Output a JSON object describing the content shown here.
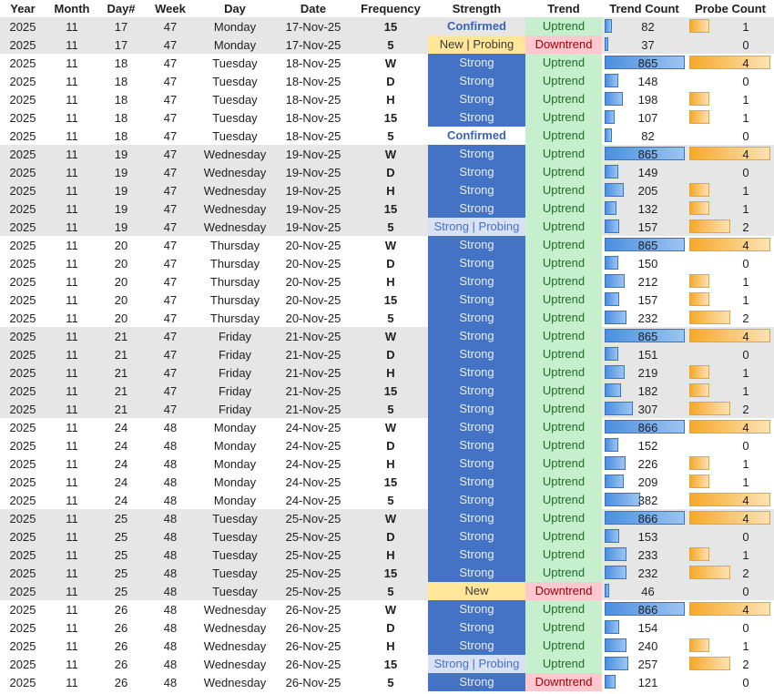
{
  "headers": {
    "year": "Year",
    "month": "Month",
    "day_num": "Day#",
    "week": "Week",
    "day": "Day",
    "date": "Date",
    "frequency": "Frequency",
    "strength": "Strength",
    "trend": "Trend",
    "trend_count": "Trend Count",
    "probe_count": "Probe Count"
  },
  "colors": {
    "strong_bg": "#4472c4",
    "uptrend_bg": "#c6efce",
    "downtrend_bg": "#ffc7ce",
    "new_bg": "#ffe699",
    "shade_bg": "#e6e6e6",
    "bar_blue": "#4a8fe0",
    "bar_orange": "#f6a92a"
  },
  "bar_max": {
    "trend_count": 866,
    "probe_count": 4
  },
  "rows": [
    {
      "year": "2025",
      "month": "11",
      "day_num": "17",
      "week": "47",
      "day": "Monday",
      "date": "17-Nov-25",
      "frequency": "15",
      "strength": "Confirmed",
      "trend": "Uptrend",
      "trend_count": "82",
      "probe_count": "1",
      "shade": true
    },
    {
      "year": "2025",
      "month": "11",
      "day_num": "17",
      "week": "47",
      "day": "Monday",
      "date": "17-Nov-25",
      "frequency": "5",
      "strength": "New | Probing",
      "trend": "Downtrend",
      "trend_count": "37",
      "probe_count": "0",
      "shade": true
    },
    {
      "year": "2025",
      "month": "11",
      "day_num": "18",
      "week": "47",
      "day": "Tuesday",
      "date": "18-Nov-25",
      "frequency": "W",
      "strength": "Strong",
      "trend": "Uptrend",
      "trend_count": "865",
      "probe_count": "4",
      "shade": false
    },
    {
      "year": "2025",
      "month": "11",
      "day_num": "18",
      "week": "47",
      "day": "Tuesday",
      "date": "18-Nov-25",
      "frequency": "D",
      "strength": "Strong",
      "trend": "Uptrend",
      "trend_count": "148",
      "probe_count": "0",
      "shade": false
    },
    {
      "year": "2025",
      "month": "11",
      "day_num": "18",
      "week": "47",
      "day": "Tuesday",
      "date": "18-Nov-25",
      "frequency": "H",
      "strength": "Strong",
      "trend": "Uptrend",
      "trend_count": "198",
      "probe_count": "1",
      "shade": false
    },
    {
      "year": "2025",
      "month": "11",
      "day_num": "18",
      "week": "47",
      "day": "Tuesday",
      "date": "18-Nov-25",
      "frequency": "15",
      "strength": "Strong",
      "trend": "Uptrend",
      "trend_count": "107",
      "probe_count": "1",
      "shade": false
    },
    {
      "year": "2025",
      "month": "11",
      "day_num": "18",
      "week": "47",
      "day": "Tuesday",
      "date": "18-Nov-25",
      "frequency": "5",
      "strength": "Confirmed",
      "trend": "Uptrend",
      "trend_count": "82",
      "probe_count": "0",
      "shade": false
    },
    {
      "year": "2025",
      "month": "11",
      "day_num": "19",
      "week": "47",
      "day": "Wednesday",
      "date": "19-Nov-25",
      "frequency": "W",
      "strength": "Strong",
      "trend": "Uptrend",
      "trend_count": "865",
      "probe_count": "4",
      "shade": true
    },
    {
      "year": "2025",
      "month": "11",
      "day_num": "19",
      "week": "47",
      "day": "Wednesday",
      "date": "19-Nov-25",
      "frequency": "D",
      "strength": "Strong",
      "trend": "Uptrend",
      "trend_count": "149",
      "probe_count": "0",
      "shade": true
    },
    {
      "year": "2025",
      "month": "11",
      "day_num": "19",
      "week": "47",
      "day": "Wednesday",
      "date": "19-Nov-25",
      "frequency": "H",
      "strength": "Strong",
      "trend": "Uptrend",
      "trend_count": "205",
      "probe_count": "1",
      "shade": true
    },
    {
      "year": "2025",
      "month": "11",
      "day_num": "19",
      "week": "47",
      "day": "Wednesday",
      "date": "19-Nov-25",
      "frequency": "15",
      "strength": "Strong",
      "trend": "Uptrend",
      "trend_count": "132",
      "probe_count": "1",
      "shade": true
    },
    {
      "year": "2025",
      "month": "11",
      "day_num": "19",
      "week": "47",
      "day": "Wednesday",
      "date": "19-Nov-25",
      "frequency": "5",
      "strength": "Strong | Probing",
      "trend": "Uptrend",
      "trend_count": "157",
      "probe_count": "2",
      "shade": true
    },
    {
      "year": "2025",
      "month": "11",
      "day_num": "20",
      "week": "47",
      "day": "Thursday",
      "date": "20-Nov-25",
      "frequency": "W",
      "strength": "Strong",
      "trend": "Uptrend",
      "trend_count": "865",
      "probe_count": "4",
      "shade": false
    },
    {
      "year": "2025",
      "month": "11",
      "day_num": "20",
      "week": "47",
      "day": "Thursday",
      "date": "20-Nov-25",
      "frequency": "D",
      "strength": "Strong",
      "trend": "Uptrend",
      "trend_count": "150",
      "probe_count": "0",
      "shade": false
    },
    {
      "year": "2025",
      "month": "11",
      "day_num": "20",
      "week": "47",
      "day": "Thursday",
      "date": "20-Nov-25",
      "frequency": "H",
      "strength": "Strong",
      "trend": "Uptrend",
      "trend_count": "212",
      "probe_count": "1",
      "shade": false
    },
    {
      "year": "2025",
      "month": "11",
      "day_num": "20",
      "week": "47",
      "day": "Thursday",
      "date": "20-Nov-25",
      "frequency": "15",
      "strength": "Strong",
      "trend": "Uptrend",
      "trend_count": "157",
      "probe_count": "1",
      "shade": false
    },
    {
      "year": "2025",
      "month": "11",
      "day_num": "20",
      "week": "47",
      "day": "Thursday",
      "date": "20-Nov-25",
      "frequency": "5",
      "strength": "Strong",
      "trend": "Uptrend",
      "trend_count": "232",
      "probe_count": "2",
      "shade": false
    },
    {
      "year": "2025",
      "month": "11",
      "day_num": "21",
      "week": "47",
      "day": "Friday",
      "date": "21-Nov-25",
      "frequency": "W",
      "strength": "Strong",
      "trend": "Uptrend",
      "trend_count": "865",
      "probe_count": "4",
      "shade": true
    },
    {
      "year": "2025",
      "month": "11",
      "day_num": "21",
      "week": "47",
      "day": "Friday",
      "date": "21-Nov-25",
      "frequency": "D",
      "strength": "Strong",
      "trend": "Uptrend",
      "trend_count": "151",
      "probe_count": "0",
      "shade": true
    },
    {
      "year": "2025",
      "month": "11",
      "day_num": "21",
      "week": "47",
      "day": "Friday",
      "date": "21-Nov-25",
      "frequency": "H",
      "strength": "Strong",
      "trend": "Uptrend",
      "trend_count": "219",
      "probe_count": "1",
      "shade": true
    },
    {
      "year": "2025",
      "month": "11",
      "day_num": "21",
      "week": "47",
      "day": "Friday",
      "date": "21-Nov-25",
      "frequency": "15",
      "strength": "Strong",
      "trend": "Uptrend",
      "trend_count": "182",
      "probe_count": "1",
      "shade": true
    },
    {
      "year": "2025",
      "month": "11",
      "day_num": "21",
      "week": "47",
      "day": "Friday",
      "date": "21-Nov-25",
      "frequency": "5",
      "strength": "Strong",
      "trend": "Uptrend",
      "trend_count": "307",
      "probe_count": "2",
      "shade": true
    },
    {
      "year": "2025",
      "month": "11",
      "day_num": "24",
      "week": "48",
      "day": "Monday",
      "date": "24-Nov-25",
      "frequency": "W",
      "strength": "Strong",
      "trend": "Uptrend",
      "trend_count": "866",
      "probe_count": "4",
      "shade": false
    },
    {
      "year": "2025",
      "month": "11",
      "day_num": "24",
      "week": "48",
      "day": "Monday",
      "date": "24-Nov-25",
      "frequency": "D",
      "strength": "Strong",
      "trend": "Uptrend",
      "trend_count": "152",
      "probe_count": "0",
      "shade": false
    },
    {
      "year": "2025",
      "month": "11",
      "day_num": "24",
      "week": "48",
      "day": "Monday",
      "date": "24-Nov-25",
      "frequency": "H",
      "strength": "Strong",
      "trend": "Uptrend",
      "trend_count": "226",
      "probe_count": "1",
      "shade": false
    },
    {
      "year": "2025",
      "month": "11",
      "day_num": "24",
      "week": "48",
      "day": "Monday",
      "date": "24-Nov-25",
      "frequency": "15",
      "strength": "Strong",
      "trend": "Uptrend",
      "trend_count": "209",
      "probe_count": "1",
      "shade": false
    },
    {
      "year": "2025",
      "month": "11",
      "day_num": "24",
      "week": "48",
      "day": "Monday",
      "date": "24-Nov-25",
      "frequency": "5",
      "strength": "Strong",
      "trend": "Uptrend",
      "trend_count": "382",
      "probe_count": "4",
      "shade": false
    },
    {
      "year": "2025",
      "month": "11",
      "day_num": "25",
      "week": "48",
      "day": "Tuesday",
      "date": "25-Nov-25",
      "frequency": "W",
      "strength": "Strong",
      "trend": "Uptrend",
      "trend_count": "866",
      "probe_count": "4",
      "shade": true
    },
    {
      "year": "2025",
      "month": "11",
      "day_num": "25",
      "week": "48",
      "day": "Tuesday",
      "date": "25-Nov-25",
      "frequency": "D",
      "strength": "Strong",
      "trend": "Uptrend",
      "trend_count": "153",
      "probe_count": "0",
      "shade": true
    },
    {
      "year": "2025",
      "month": "11",
      "day_num": "25",
      "week": "48",
      "day": "Tuesday",
      "date": "25-Nov-25",
      "frequency": "H",
      "strength": "Strong",
      "trend": "Uptrend",
      "trend_count": "233",
      "probe_count": "1",
      "shade": true
    },
    {
      "year": "2025",
      "month": "11",
      "day_num": "25",
      "week": "48",
      "day": "Tuesday",
      "date": "25-Nov-25",
      "frequency": "15",
      "strength": "Strong",
      "trend": "Uptrend",
      "trend_count": "232",
      "probe_count": "2",
      "shade": true
    },
    {
      "year": "2025",
      "month": "11",
      "day_num": "25",
      "week": "48",
      "day": "Tuesday",
      "date": "25-Nov-25",
      "frequency": "5",
      "strength": "New",
      "trend": "Downtrend",
      "trend_count": "46",
      "probe_count": "0",
      "shade": true
    },
    {
      "year": "2025",
      "month": "11",
      "day_num": "26",
      "week": "48",
      "day": "Wednesday",
      "date": "26-Nov-25",
      "frequency": "W",
      "strength": "Strong",
      "trend": "Uptrend",
      "trend_count": "866",
      "probe_count": "4",
      "shade": false
    },
    {
      "year": "2025",
      "month": "11",
      "day_num": "26",
      "week": "48",
      "day": "Wednesday",
      "date": "26-Nov-25",
      "frequency": "D",
      "strength": "Strong",
      "trend": "Uptrend",
      "trend_count": "154",
      "probe_count": "0",
      "shade": false
    },
    {
      "year": "2025",
      "month": "11",
      "day_num": "26",
      "week": "48",
      "day": "Wednesday",
      "date": "26-Nov-25",
      "frequency": "H",
      "strength": "Strong",
      "trend": "Uptrend",
      "trend_count": "240",
      "probe_count": "1",
      "shade": false
    },
    {
      "year": "2025",
      "month": "11",
      "day_num": "26",
      "week": "48",
      "day": "Wednesday",
      "date": "26-Nov-25",
      "frequency": "15",
      "strength": "Strong | Probing",
      "trend": "Uptrend",
      "trend_count": "257",
      "probe_count": "2",
      "shade": false
    },
    {
      "year": "2025",
      "month": "11",
      "day_num": "26",
      "week": "48",
      "day": "Wednesday",
      "date": "26-Nov-25",
      "frequency": "5",
      "strength": "Strong",
      "trend": "Downtrend",
      "trend_count": "121",
      "probe_count": "0",
      "shade": false
    }
  ]
}
